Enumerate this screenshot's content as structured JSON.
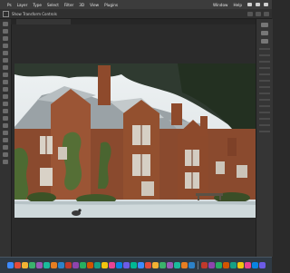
{
  "menubar": {
    "items": [
      "Ps",
      "Layer",
      "Type",
      "Select",
      "Filter",
      "3D",
      "View",
      "Plugins"
    ],
    "right_items": [
      "Window",
      "Help"
    ]
  },
  "optionsbar": {
    "label": "Show Transform Controls"
  },
  "colors": {
    "menubar_bg": "#3c3c3c",
    "workspace_bg": "#2b2b2b",
    "dock_bg": "#2f3a44"
  },
  "dock": {
    "icons": [
      "finder-icon",
      "launchpad-icon",
      "safari-icon",
      "chrome-icon",
      "mail-icon",
      "messages-icon",
      "maps-icon",
      "photos-icon",
      "facetime-icon",
      "calendar-icon",
      "contacts-icon",
      "reminders-icon",
      "notes-icon",
      "music-icon",
      "podcasts-icon",
      "tv-icon",
      "news-icon",
      "app-store-icon",
      "settings-icon",
      "photoshop-icon",
      "lightroom-icon",
      "illustrator-icon",
      "premiere-icon",
      "aftereffects-icon",
      "terminal-icon",
      "preview-icon",
      "calculator-icon",
      "weather-icon",
      "spotify-icon",
      "slack-icon",
      "zoom-icon",
      "notion-icon",
      "figma-icon",
      "vscode-icon",
      "trash-icon"
    ]
  }
}
